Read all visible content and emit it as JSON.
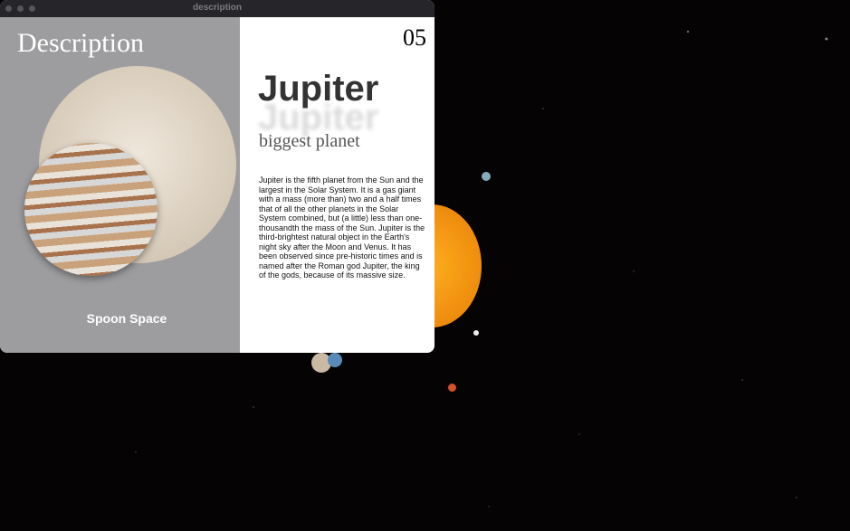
{
  "window": {
    "title": "description"
  },
  "left_panel": {
    "heading": "Description",
    "footer": "Spoon Space"
  },
  "right_panel": {
    "number": "05",
    "planet_name": "Jupiter",
    "subtitle": "biggest planet",
    "description": "Jupiter is the fifth planet from the Sun and the largest in the Solar System. It is a gas giant with a mass (more than) two and a half times that of all the other planets in the Solar System combined, but (a little) less than one-thousandth the mass of the Sun. Jupiter is the third-brightest natural object in the Earth's night sky after the Moon and Venus. It has been observed since pre-historic times and is named after the Roman god Jupiter, the king of the gods, because of its massive size."
  },
  "colors": {
    "sun": "#f59a10",
    "panel": "#9d9d9f"
  }
}
